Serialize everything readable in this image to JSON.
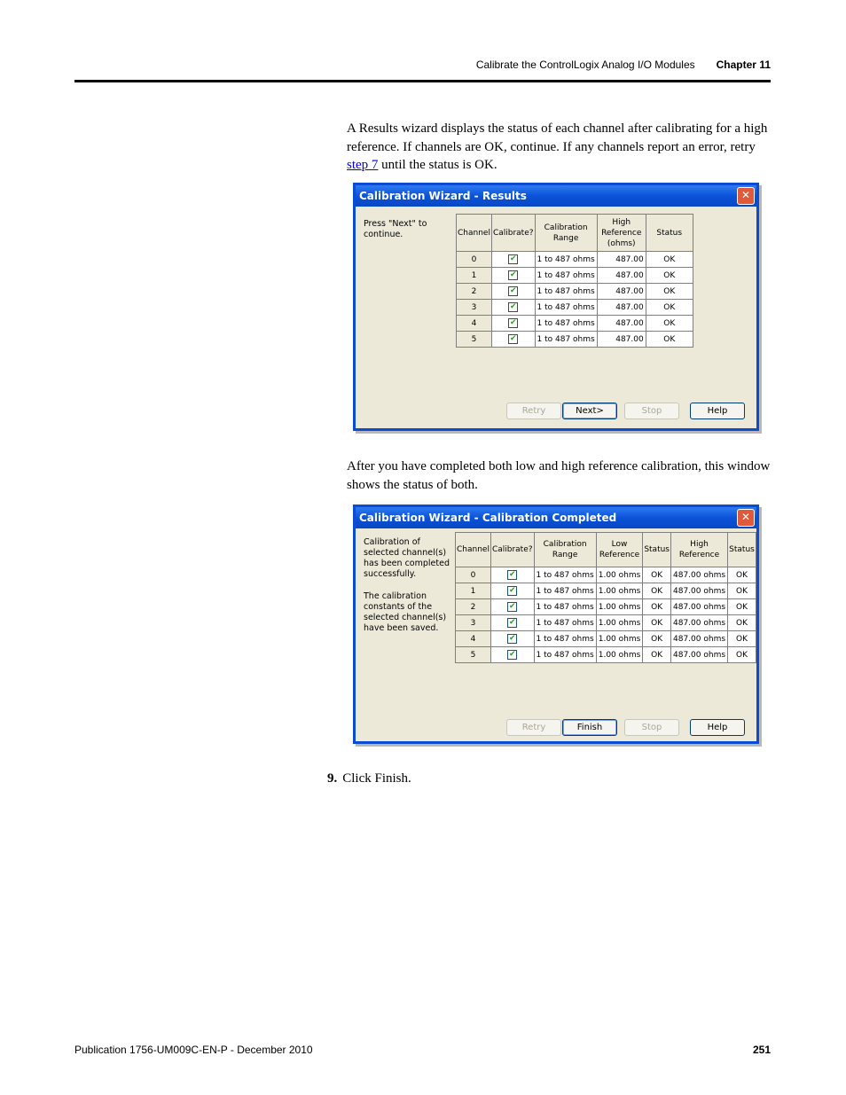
{
  "header": {
    "section": "Calibrate the ControlLogix Analog I/O Modules",
    "chapter": "Chapter 11"
  },
  "para1": {
    "before": "A Results wizard displays the status of each channel after calibrating for a high reference. If channels are OK, continue. If any channels report an error, retry ",
    "link": "step 7",
    "after": " until the status is OK."
  },
  "dialog1": {
    "title": "Calibration Wizard - Results",
    "message": "Press \"Next\" to continue.",
    "headers": [
      "Channel",
      "Calibrate?",
      "Calibration Range",
      "High Reference (ohms)",
      "Status"
    ],
    "rows": [
      {
        "channel": "0",
        "range": "1 to 487 ohms",
        "high": "487.00",
        "status": "OK"
      },
      {
        "channel": "1",
        "range": "1 to 487 ohms",
        "high": "487.00",
        "status": "OK"
      },
      {
        "channel": "2",
        "range": "1 to 487 ohms",
        "high": "487.00",
        "status": "OK"
      },
      {
        "channel": "3",
        "range": "1 to 487 ohms",
        "high": "487.00",
        "status": "OK"
      },
      {
        "channel": "4",
        "range": "1 to 487 ohms",
        "high": "487.00",
        "status": "OK"
      },
      {
        "channel": "5",
        "range": "1 to 487 ohms",
        "high": "487.00",
        "status": "OK"
      }
    ],
    "buttons": {
      "retry": "Retry",
      "next": "Next>",
      "stop": "Stop",
      "help": "Help"
    }
  },
  "para2": "After you have completed both low and high reference calibration, this window shows the status of both.",
  "dialog2": {
    "title": "Calibration Wizard - Calibration Completed",
    "message1": "Calibration of selected channel(s) has been completed successfully.",
    "message2": "The calibration constants of the selected channel(s) have been saved.",
    "headers": [
      "Channel",
      "Calibrate?",
      "Calibration Range",
      "Low Reference",
      "Status",
      "High Reference",
      "Status"
    ],
    "rows": [
      {
        "channel": "0",
        "range": "1 to 487 ohms",
        "low": "1.00 ohms",
        "low_status": "OK",
        "high": "487.00 ohms",
        "high_status": "OK"
      },
      {
        "channel": "1",
        "range": "1 to 487 ohms",
        "low": "1.00 ohms",
        "low_status": "OK",
        "high": "487.00 ohms",
        "high_status": "OK"
      },
      {
        "channel": "2",
        "range": "1 to 487 ohms",
        "low": "1.00 ohms",
        "low_status": "OK",
        "high": "487.00 ohms",
        "high_status": "OK"
      },
      {
        "channel": "3",
        "range": "1 to 487 ohms",
        "low": "1.00 ohms",
        "low_status": "OK",
        "high": "487.00 ohms",
        "high_status": "OK"
      },
      {
        "channel": "4",
        "range": "1 to 487 ohms",
        "low": "1.00 ohms",
        "low_status": "OK",
        "high": "487.00 ohms",
        "high_status": "OK"
      },
      {
        "channel": "5",
        "range": "1 to 487 ohms",
        "low": "1.00 ohms",
        "low_status": "OK",
        "high": "487.00 ohms",
        "high_status": "OK"
      }
    ],
    "buttons": {
      "retry": "Retry",
      "finish": "Finish",
      "stop": "Stop",
      "help": "Help"
    }
  },
  "step": {
    "number": "9.",
    "text": "Click Finish."
  },
  "footer": {
    "publication": "Publication 1756-UM009C-EN-P - December 2010",
    "page": "251"
  }
}
